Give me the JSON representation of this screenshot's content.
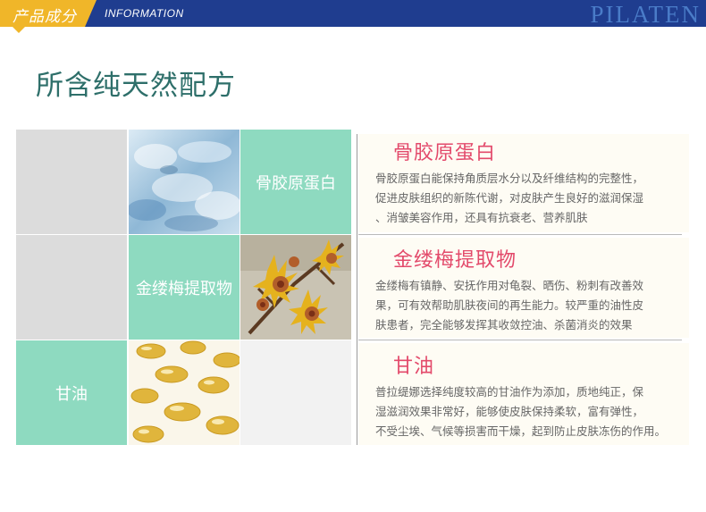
{
  "header": {
    "tab_title": "产品成分",
    "subtitle": "INFORMATION",
    "brand": "PILATEN"
  },
  "section_title": "所含纯天然配方",
  "grid": {
    "cell_labels": [
      "骨胶原蛋白",
      "金缕梅提取物",
      "甘油"
    ]
  },
  "items": [
    {
      "title": "骨胶原蛋白",
      "lines": [
        "骨胶原蛋白能保持角质层水分以及纤维结构的完整性，",
        "促进皮肤组织的新陈代谢，对皮肤产生良好的滋润保湿",
        "、消皱美容作用，还具有抗衰老、营养肌肤"
      ]
    },
    {
      "title": "金缕梅提取物",
      "lines": [
        "金缕梅有镇静、安抚作用对龟裂、晒伤、粉刺有改善效",
        "果，可有效帮助肌肤夜间的再生能力。较严重的油性皮",
        "肤患者，完全能够发挥其收敛控油、杀菌消炎的效果"
      ]
    },
    {
      "title": "甘油",
      "lines": [
        "普拉缇娜选择纯度较高的甘油作为添加，质地纯正，保",
        "湿滋润效果非常好，能够使皮肤保持柔软，富有弹性，",
        "不受尘埃、气候等损害而干燥，起到防止皮肤冻伤的作用。"
      ]
    }
  ],
  "colors": {
    "header_bg": "#1f3d8f",
    "tab_bg": "#f0b629",
    "brand": "#4a7cc8",
    "mint": "#8edac0",
    "title_pink": "#e34a6b",
    "heading_teal": "#2e6f6a"
  }
}
